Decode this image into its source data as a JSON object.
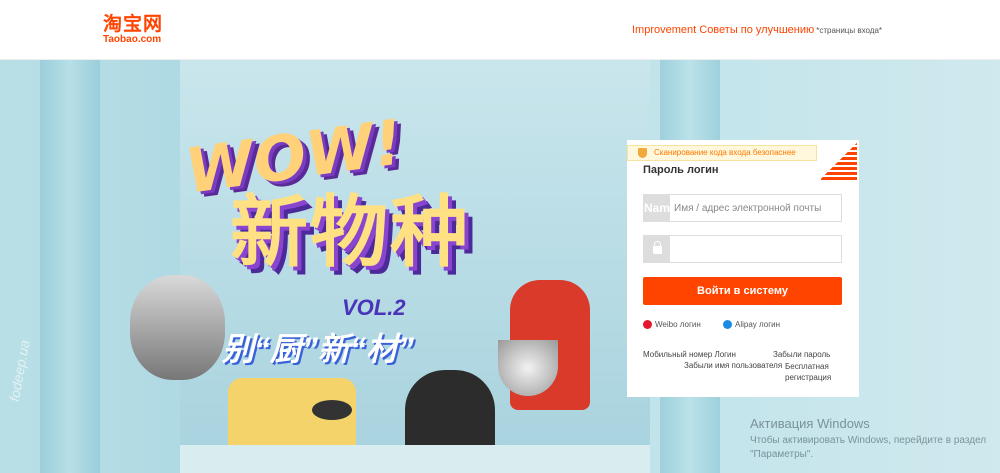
{
  "header": {
    "logo_cn": "淘宝网",
    "logo_en": "Taobao.com",
    "improve_link": "Improvement Советы по улучшению",
    "improve_note": "*страницы входа*"
  },
  "banner": {
    "wow": "WOW!",
    "headline": "新物种",
    "vol": "VOL.2",
    "slogan": "别“厨”新“材”",
    "side_watermark": "fodeep.ua"
  },
  "login": {
    "scan_notice": "Сканирование кода входа безопаснее",
    "title": "Пароль логин",
    "username_icon": "Nam",
    "username_placeholder": "Имя / адрес электронной почты",
    "username_value": "",
    "password_placeholder": "",
    "password_value": "",
    "submit_label": "Войти в систему",
    "weibo_label": "Weibo логин",
    "alipay_label": "Alipay логин",
    "mobile_login": "Мобильный номер Логин",
    "forgot_password": "Забыли пароль",
    "forgot_username": "Забыли имя пользователя",
    "register": "Бесплатная регистрация"
  },
  "windows_activation": {
    "title": "Активация Windows",
    "description": "Чтобы активировать Windows, перейдите в раздел \"Параметры\"."
  },
  "colors": {
    "accent": "#ff4400",
    "scan_bg": "#fff8dd",
    "banner_bg": "#b9dfe6"
  },
  "icons": {
    "shield": "shield-icon",
    "qr": "qr-code-icon",
    "lock": "lock-icon",
    "weibo": "weibo-icon",
    "alipay": "alipay-icon"
  }
}
